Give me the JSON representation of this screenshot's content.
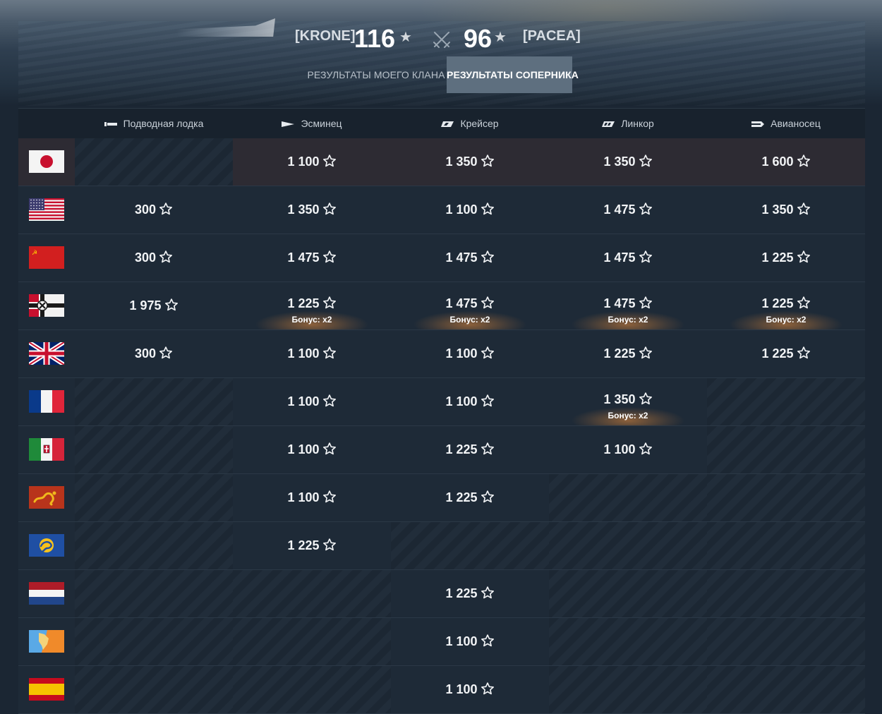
{
  "header": {
    "clan_left": "[KRONE]",
    "score_left": "116",
    "clan_right": "[PACEA]",
    "score_right": "96",
    "star_icon": "star-icon",
    "versus_icon": "crossed-swords-icon"
  },
  "tabs": [
    {
      "label": "РЕЗУЛЬТАТЫ МОЕГО КЛАНА",
      "active": false
    },
    {
      "label": "РЕЗУЛЬТАТЫ СОПЕРНИКА",
      "active": true
    }
  ],
  "columns": [
    {
      "label": "Подводная лодка",
      "icon": "submarine-icon"
    },
    {
      "label": "Эсминец",
      "icon": "destroyer-icon"
    },
    {
      "label": "Крейсер",
      "icon": "cruiser-icon"
    },
    {
      "label": "Линкор",
      "icon": "battleship-icon"
    },
    {
      "label": "Авианосец",
      "icon": "aircraft-carrier-icon"
    }
  ],
  "bonus_label": "Бонус: x2",
  "rows": [
    {
      "nation": "japan",
      "flag_icon": "japan-flag-icon",
      "highlighted": true,
      "cells": [
        null,
        {
          "v": "1 100"
        },
        {
          "v": "1 350"
        },
        {
          "v": "1 350"
        },
        {
          "v": "1 600"
        }
      ]
    },
    {
      "nation": "usa",
      "flag_icon": "usa-flag-icon",
      "cells": [
        {
          "v": "300"
        },
        {
          "v": "1 350"
        },
        {
          "v": "1 100"
        },
        {
          "v": "1 475"
        },
        {
          "v": "1 350"
        }
      ]
    },
    {
      "nation": "ussr",
      "flag_icon": "ussr-flag-icon",
      "cells": [
        {
          "v": "300"
        },
        {
          "v": "1 475"
        },
        {
          "v": "1 475"
        },
        {
          "v": "1 475"
        },
        {
          "v": "1 225"
        }
      ]
    },
    {
      "nation": "germany",
      "flag_icon": "germany-flag-icon",
      "cells": [
        {
          "v": "1 975"
        },
        {
          "v": "1 225",
          "bonus": true
        },
        {
          "v": "1 475",
          "bonus": true
        },
        {
          "v": "1 475",
          "bonus": true
        },
        {
          "v": "1 225",
          "bonus": true
        }
      ]
    },
    {
      "nation": "uk",
      "flag_icon": "uk-flag-icon",
      "cells": [
        {
          "v": "300"
        },
        {
          "v": "1 100"
        },
        {
          "v": "1 100"
        },
        {
          "v": "1 225"
        },
        {
          "v": "1 225"
        }
      ]
    },
    {
      "nation": "france",
      "flag_icon": "france-flag-icon",
      "cells": [
        null,
        {
          "v": "1 100"
        },
        {
          "v": "1 100"
        },
        {
          "v": "1 350",
          "bonus": true
        },
        null
      ]
    },
    {
      "nation": "italy",
      "flag_icon": "italy-flag-icon",
      "cells": [
        null,
        {
          "v": "1 100"
        },
        {
          "v": "1 225"
        },
        {
          "v": "1 100"
        },
        null
      ]
    },
    {
      "nation": "pan-asia",
      "flag_icon": "pan-asia-flag-icon",
      "cells": [
        null,
        {
          "v": "1 100"
        },
        {
          "v": "1 225"
        },
        null,
        null
      ]
    },
    {
      "nation": "europe",
      "flag_icon": "europe-flag-icon",
      "cells": [
        null,
        {
          "v": "1 225"
        },
        null,
        null,
        null
      ]
    },
    {
      "nation": "netherlands",
      "flag_icon": "netherlands-flag-icon",
      "cells": [
        null,
        null,
        {
          "v": "1 225"
        },
        null,
        null
      ]
    },
    {
      "nation": "pan-america",
      "flag_icon": "pan-america-flag-icon",
      "cells": [
        null,
        null,
        {
          "v": "1 100"
        },
        null,
        null
      ]
    },
    {
      "nation": "spain",
      "flag_icon": "spain-flag-icon",
      "cells": [
        null,
        null,
        {
          "v": "1 100"
        },
        null,
        null
      ]
    }
  ]
}
